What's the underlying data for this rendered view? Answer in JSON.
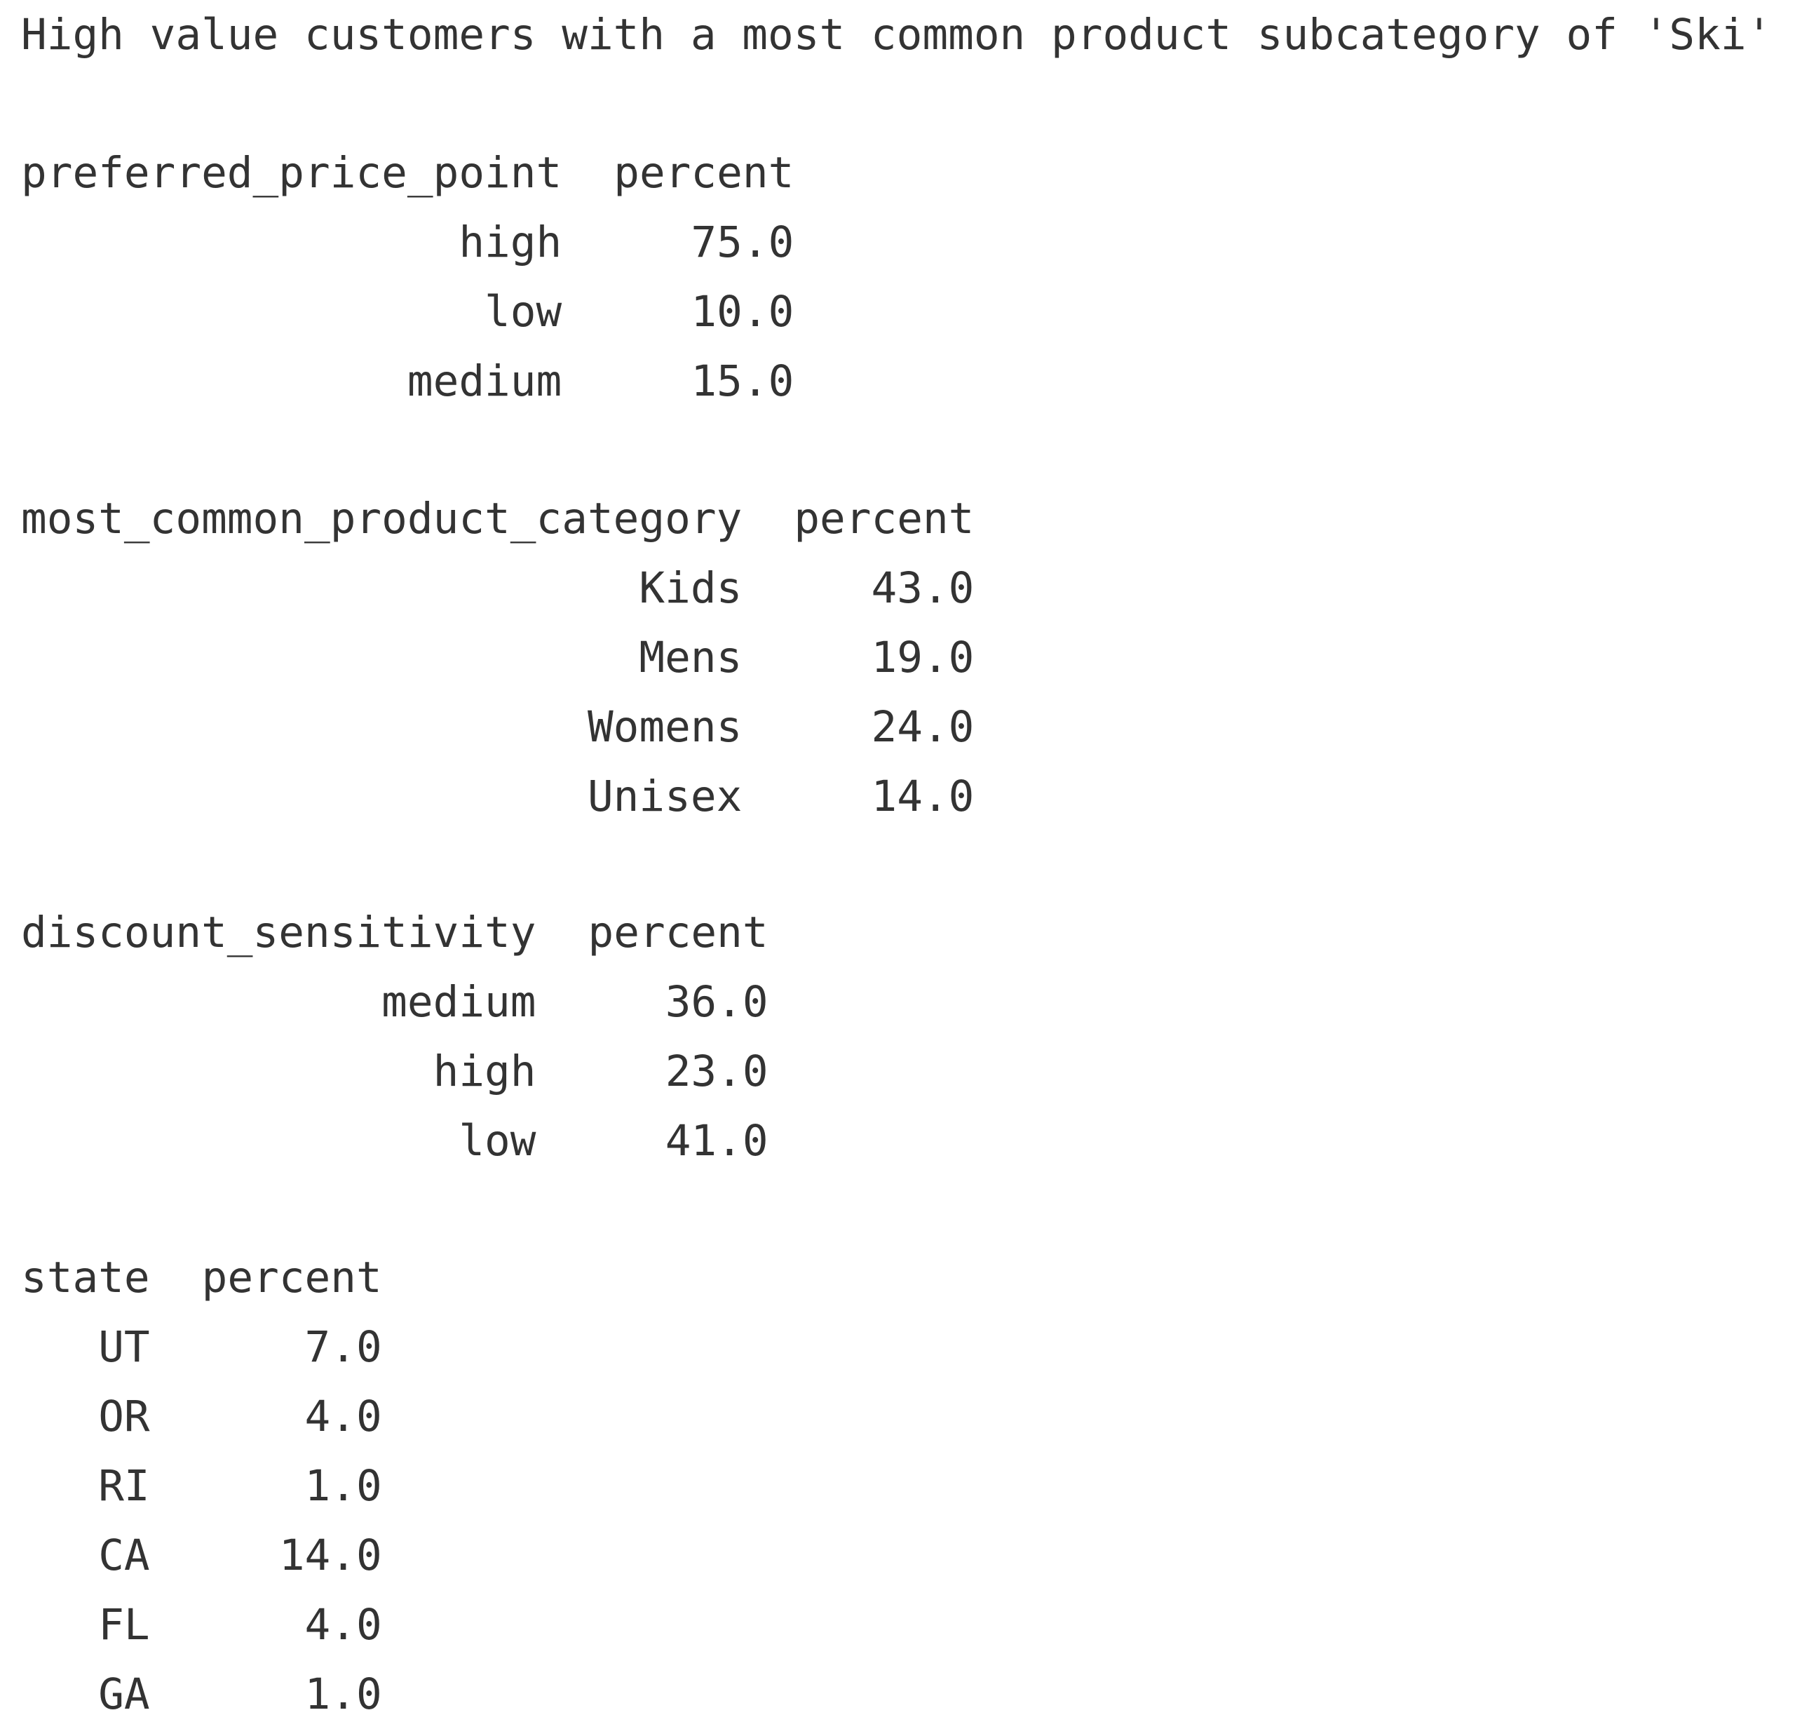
{
  "title": "High value customers with a most common product subcategory of 'Ski'",
  "tables": [
    {
      "index_header": "preferred_price_point",
      "value_header": "percent",
      "rows": [
        {
          "label": "high",
          "value": "75.0"
        },
        {
          "label": "low",
          "value": "10.0"
        },
        {
          "label": "medium",
          "value": "15.0"
        }
      ]
    },
    {
      "index_header": "most_common_product_category",
      "value_header": "percent",
      "rows": [
        {
          "label": "Kids",
          "value": "43.0"
        },
        {
          "label": "Mens",
          "value": "19.0"
        },
        {
          "label": "Womens",
          "value": "24.0"
        },
        {
          "label": "Unisex",
          "value": "14.0"
        }
      ]
    },
    {
      "index_header": "discount_sensitivity",
      "value_header": "percent",
      "rows": [
        {
          "label": "medium",
          "value": "36.0"
        },
        {
          "label": "high",
          "value": "23.0"
        },
        {
          "label": "low",
          "value": "41.0"
        }
      ]
    },
    {
      "index_header": "state",
      "value_header": "percent",
      "rows": [
        {
          "label": "UT",
          "value": "7.0"
        },
        {
          "label": "OR",
          "value": "4.0"
        },
        {
          "label": "RI",
          "value": "1.0"
        },
        {
          "label": "CA",
          "value": "14.0"
        },
        {
          "label": "FL",
          "value": "4.0"
        },
        {
          "label": "GA",
          "value": "1.0"
        }
      ]
    }
  ]
}
